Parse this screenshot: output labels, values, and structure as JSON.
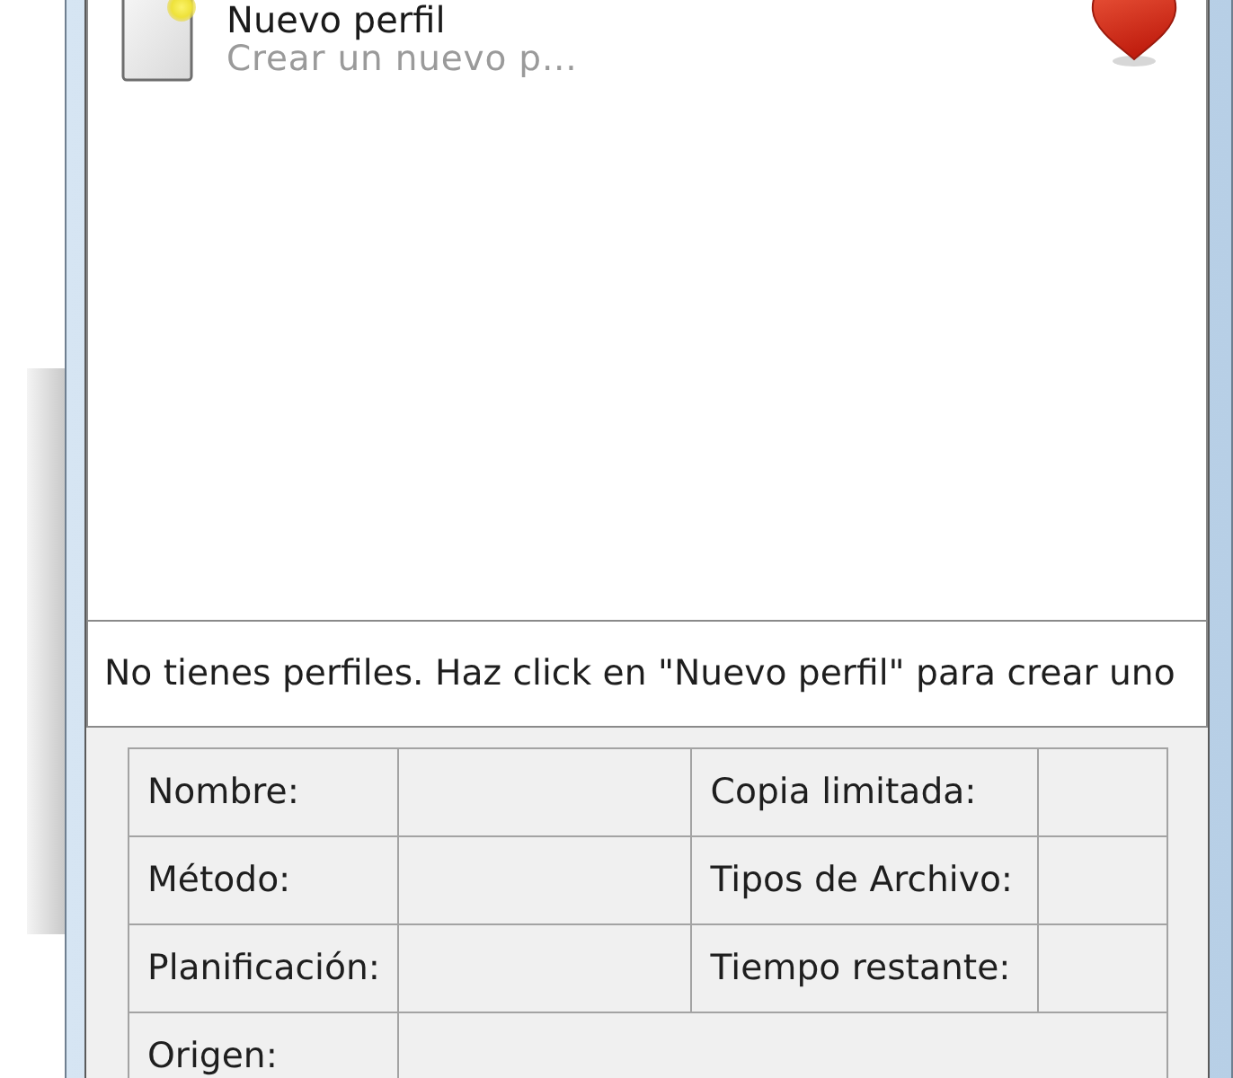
{
  "profile_list": {
    "items": [
      {
        "title": "Nuevo perfil",
        "subtitle": "Crear un nuevo p..."
      }
    ]
  },
  "message": "No tienes perfiles. Haz click en \"Nuevo perfil\" para crear uno",
  "details": {
    "rows": [
      [
        {
          "label": "Nombre:"
        },
        {
          "label": "Copia limitada:"
        }
      ],
      [
        {
          "label": "Método:"
        },
        {
          "label": "Tipos de Archivo:"
        }
      ],
      [
        {
          "label": "Planificación:"
        },
        {
          "label": "Tiempo restante:"
        }
      ],
      [
        {
          "label": "Origen:"
        }
      ]
    ]
  }
}
